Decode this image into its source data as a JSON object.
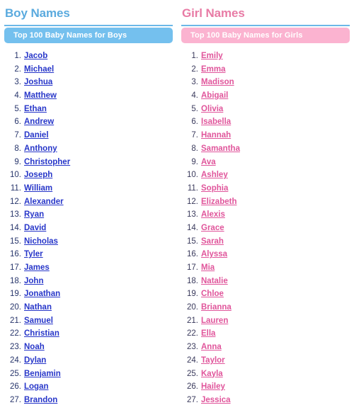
{
  "colors": {
    "boy_heading": "#5aaade",
    "girl_heading": "#e87ba5",
    "boy_banner": "#74c0ee",
    "girl_banner": "#fbb3d0",
    "rule": "#6cb8e8",
    "boy_link": "#2736c9",
    "girl_link": "#e0559b",
    "number": "#27356b"
  },
  "boys": {
    "heading": "Boy Names",
    "banner": "Top 100 Baby Names for Boys",
    "names": [
      "Jacob",
      "Michael",
      "Joshua",
      "Matthew",
      "Ethan",
      "Andrew",
      "Daniel",
      "Anthony",
      "Christopher",
      "Joseph",
      "William",
      "Alexander",
      "Ryan",
      "David",
      "Nicholas",
      "Tyler",
      "James",
      "John",
      "Jonathan",
      "Nathan",
      "Samuel",
      "Christian",
      "Noah",
      "Dylan",
      "Benjamin",
      "Logan",
      "Brandon"
    ]
  },
  "girls": {
    "heading": "Girl Names",
    "banner": "Top 100 Baby Names for Girls",
    "names": [
      "Emily",
      "Emma",
      "Madison",
      "Abigail",
      "Olivia",
      "Isabella",
      "Hannah",
      "Samantha",
      "Ava",
      "Ashley",
      "Sophia",
      "Elizabeth",
      "Alexis",
      "Grace",
      "Sarah",
      "Alyssa",
      "Mia",
      "Natalie",
      "Chloe",
      "Brianna",
      "Lauren",
      "Ella",
      "Anna",
      "Taylor",
      "Kayla",
      "Hailey",
      "Jessica"
    ]
  }
}
